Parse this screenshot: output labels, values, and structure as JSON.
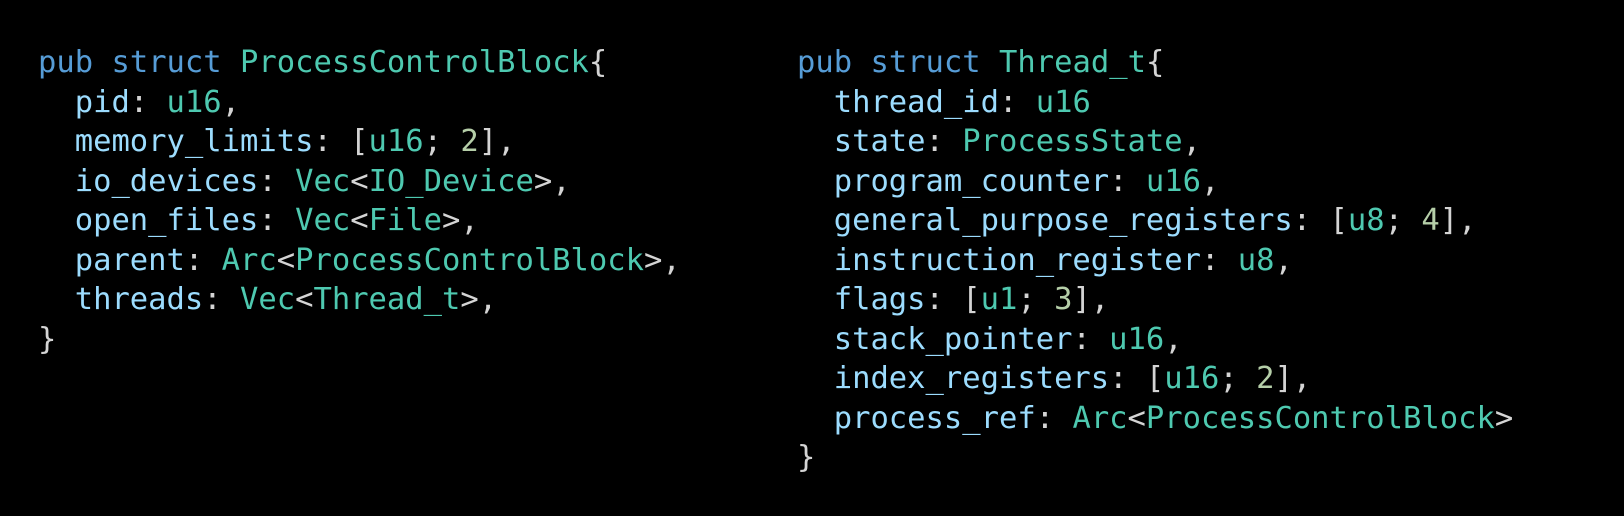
{
  "colors": {
    "background": "#000000",
    "keyword": "#569cd6",
    "type": "#4ec9b0",
    "field": "#9cdcfe",
    "number": "#b5cea8",
    "punctuation": "#d4d4d4"
  },
  "blocks": [
    {
      "header": {
        "kw1": "pub",
        "kw2": "struct",
        "name": "ProcessControlBlock",
        "open": "{"
      },
      "fields": [
        {
          "name": "pid",
          "tokens": [
            {
              "t": "u16",
              "c": "ty"
            },
            {
              "t": ",",
              "c": "punc"
            }
          ]
        },
        {
          "name": "memory_limits",
          "tokens": [
            {
              "t": "[",
              "c": "punc"
            },
            {
              "t": "u16",
              "c": "ty"
            },
            {
              "t": "; ",
              "c": "punc"
            },
            {
              "t": "2",
              "c": "num"
            },
            {
              "t": "],",
              "c": "punc"
            }
          ]
        },
        {
          "name": "io_devices",
          "tokens": [
            {
              "t": "Vec",
              "c": "ty"
            },
            {
              "t": "<",
              "c": "punc"
            },
            {
              "t": "IO_Device",
              "c": "ty"
            },
            {
              "t": ">,",
              "c": "punc"
            }
          ]
        },
        {
          "name": "open_files",
          "tokens": [
            {
              "t": "Vec",
              "c": "ty"
            },
            {
              "t": "<",
              "c": "punc"
            },
            {
              "t": "File",
              "c": "ty"
            },
            {
              "t": ">,",
              "c": "punc"
            }
          ]
        },
        {
          "name": "parent",
          "tokens": [
            {
              "t": "Arc",
              "c": "ty"
            },
            {
              "t": "<",
              "c": "punc"
            },
            {
              "t": "ProcessControlBlock",
              "c": "ty"
            },
            {
              "t": ">,",
              "c": "punc"
            }
          ]
        },
        {
          "name": "threads",
          "tokens": [
            {
              "t": "Vec",
              "c": "ty"
            },
            {
              "t": "<",
              "c": "punc"
            },
            {
              "t": "Thread_t",
              "c": "ty"
            },
            {
              "t": ">,",
              "c": "punc"
            }
          ]
        }
      ],
      "close": "}"
    },
    {
      "header": {
        "kw1": "pub",
        "kw2": "struct",
        "name": "Thread_t",
        "open": "{"
      },
      "fields": [
        {
          "name": "thread_id",
          "tokens": [
            {
              "t": "u16",
              "c": "ty"
            }
          ]
        },
        {
          "name": "state",
          "tokens": [
            {
              "t": "ProcessState",
              "c": "ty"
            },
            {
              "t": ",",
              "c": "punc"
            }
          ]
        },
        {
          "name": "program_counter",
          "tokens": [
            {
              "t": "u16",
              "c": "ty"
            },
            {
              "t": ",",
              "c": "punc"
            }
          ]
        },
        {
          "name": "general_purpose_registers",
          "tokens": [
            {
              "t": "[",
              "c": "punc"
            },
            {
              "t": "u8",
              "c": "ty"
            },
            {
              "t": "; ",
              "c": "punc"
            },
            {
              "t": "4",
              "c": "num"
            },
            {
              "t": "],",
              "c": "punc"
            }
          ]
        },
        {
          "name": "instruction_register",
          "tokens": [
            {
              "t": "u8",
              "c": "ty"
            },
            {
              "t": ",",
              "c": "punc"
            }
          ]
        },
        {
          "name": "flags",
          "tokens": [
            {
              "t": "[",
              "c": "punc"
            },
            {
              "t": "u1",
              "c": "ty"
            },
            {
              "t": "; ",
              "c": "punc"
            },
            {
              "t": "3",
              "c": "num"
            },
            {
              "t": "],",
              "c": "punc"
            }
          ]
        },
        {
          "name": "stack_pointer",
          "tokens": [
            {
              "t": "u16",
              "c": "ty"
            },
            {
              "t": ",",
              "c": "punc"
            }
          ]
        },
        {
          "name": "index_registers",
          "tokens": [
            {
              "t": "[",
              "c": "punc"
            },
            {
              "t": "u16",
              "c": "ty"
            },
            {
              "t": "; ",
              "c": "punc"
            },
            {
              "t": "2",
              "c": "num"
            },
            {
              "t": "],",
              "c": "punc"
            }
          ]
        },
        {
          "name": "process_ref",
          "tokens": [
            {
              "t": "Arc",
              "c": "ty"
            },
            {
              "t": "<",
              "c": "punc"
            },
            {
              "t": "ProcessControlBlock",
              "c": "ty"
            },
            {
              "t": ">",
              "c": "punc"
            }
          ]
        }
      ],
      "close": "}"
    }
  ]
}
